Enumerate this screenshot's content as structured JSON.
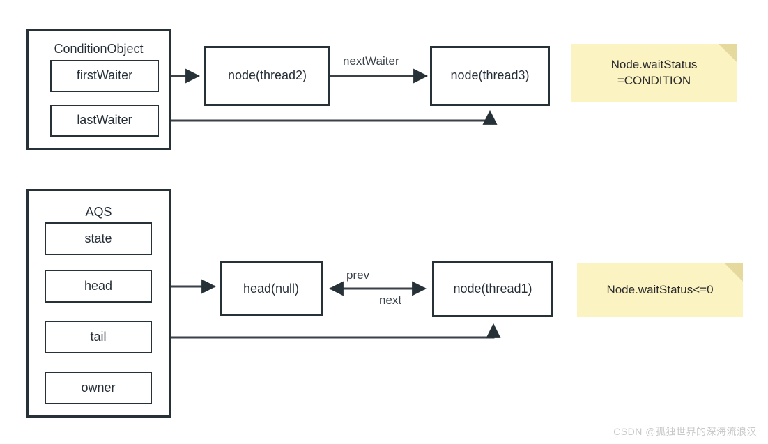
{
  "diagram": {
    "title_condition": "ConditionObject",
    "title_aqs": "AQS",
    "condition": {
      "fields": [
        {
          "label": "firstWaiter"
        },
        {
          "label": "lastWaiter"
        }
      ],
      "nodes": [
        {
          "label": "node(thread2)"
        },
        {
          "label": "node(thread3)"
        }
      ],
      "edges": [
        {
          "label": "nextWaiter"
        }
      ],
      "note": {
        "line1": "Node.waitStatus",
        "line2": "=CONDITION",
        "text": "Node.waitStatus\n=CONDITION"
      }
    },
    "aqs": {
      "fields": [
        {
          "label": "state"
        },
        {
          "label": "head"
        },
        {
          "label": "tail"
        },
        {
          "label": "owner"
        }
      ],
      "nodes": [
        {
          "label": "head(null)"
        },
        {
          "label": "node(thread1)"
        }
      ],
      "edges": [
        {
          "label": "prev"
        },
        {
          "label": "next"
        }
      ],
      "note": {
        "text": "Node.waitStatus<=0"
      }
    }
  },
  "colors": {
    "stroke": "#263238",
    "note_bg": "#fbf3c2",
    "note_fold": "#e6d99d",
    "background": "#ffffff",
    "watermark": "#c9c9c9"
  },
  "watermark": {
    "text": "CSDN @孤独世界的深海流浪汉"
  }
}
